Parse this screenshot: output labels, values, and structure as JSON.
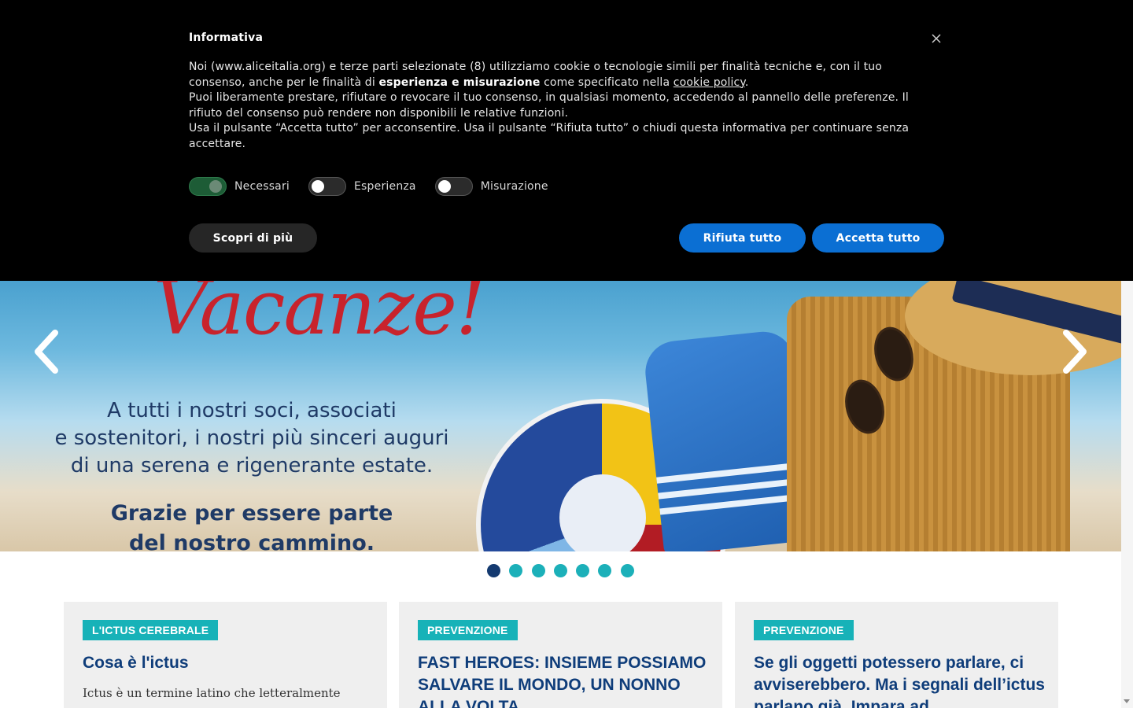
{
  "cookie_banner": {
    "title": "Informativa",
    "text_p1_a": "Noi (www.aliceitalia.org) e terze parti selezionate (8) utilizziamo cookie o tecnologie simili per finalità tecniche e, con il tuo consenso, anche per le finalità di ",
    "text_p1_bold": "esperienza e misurazione",
    "text_p1_b": " come specificato nella ",
    "text_p1_link": "cookie policy",
    "text_p1_end": ".",
    "text_p2": "Puoi liberamente prestare, rifiutare o revocare il tuo consenso, in qualsiasi momento, accedendo al pannello delle preferenze. Il rifiuto del consenso può rendere non disponibili le relative funzioni.",
    "text_p3": "Usa il pulsante “Accetta tutto” per acconsentire. Usa il pulsante “Rifiuta tutto” o chiudi questa informativa per continuare senza accettare.",
    "toggles": [
      {
        "label": "Necessari",
        "state": "on"
      },
      {
        "label": "Esperienza",
        "state": "off"
      },
      {
        "label": "Misurazione",
        "state": "off"
      }
    ],
    "learn_more_label": "Scopri di più",
    "reject_label": "Rifiuta tutto",
    "accept_label": "Accetta tutto",
    "close_icon": "close-icon",
    "colors": {
      "background": "#000000",
      "button_blue": "#0b6fd3",
      "toggle_on": "#1d5c36"
    }
  },
  "hero_slider": {
    "script_title": "Vacanze!",
    "lines": [
      "A tutti i nostri soci, associati",
      "e sostenitori, i nostri più sinceri auguri",
      "di una serena e rigenerante estate."
    ],
    "bold_lines": [
      "Grazie per essere parte",
      "del nostro cammino."
    ],
    "prev_icon": "chevron-left-icon",
    "next_icon": "chevron-right-icon",
    "slide_count": 7,
    "active_slide": 1,
    "colors": {
      "dot": "#1cb0b9",
      "dot_active": "#143a70",
      "title_red": "#c8232c"
    }
  },
  "cards": [
    {
      "tag": "L'ICTUS CEREBRALE",
      "title": "Cosa è l'ictus",
      "excerpt": "Ictus è un termine latino che letteralmente"
    },
    {
      "tag": "PREVENZIONE",
      "title": "FAST HEROES: INSIEME POSSIAMO SALVARE IL MONDO, UN NONNO ALLA VOLTA",
      "excerpt": ""
    },
    {
      "tag": "PREVENZIONE",
      "title": "Se gli oggetti potessero parlare, ci avviserebbero. Ma i segnali dell’ictus parlano già. Impara ad",
      "excerpt": ""
    }
  ],
  "colors": {
    "tag_bg": "#17b2b8",
    "card_title": "#0f3d7a",
    "card_bg": "#efefef"
  }
}
